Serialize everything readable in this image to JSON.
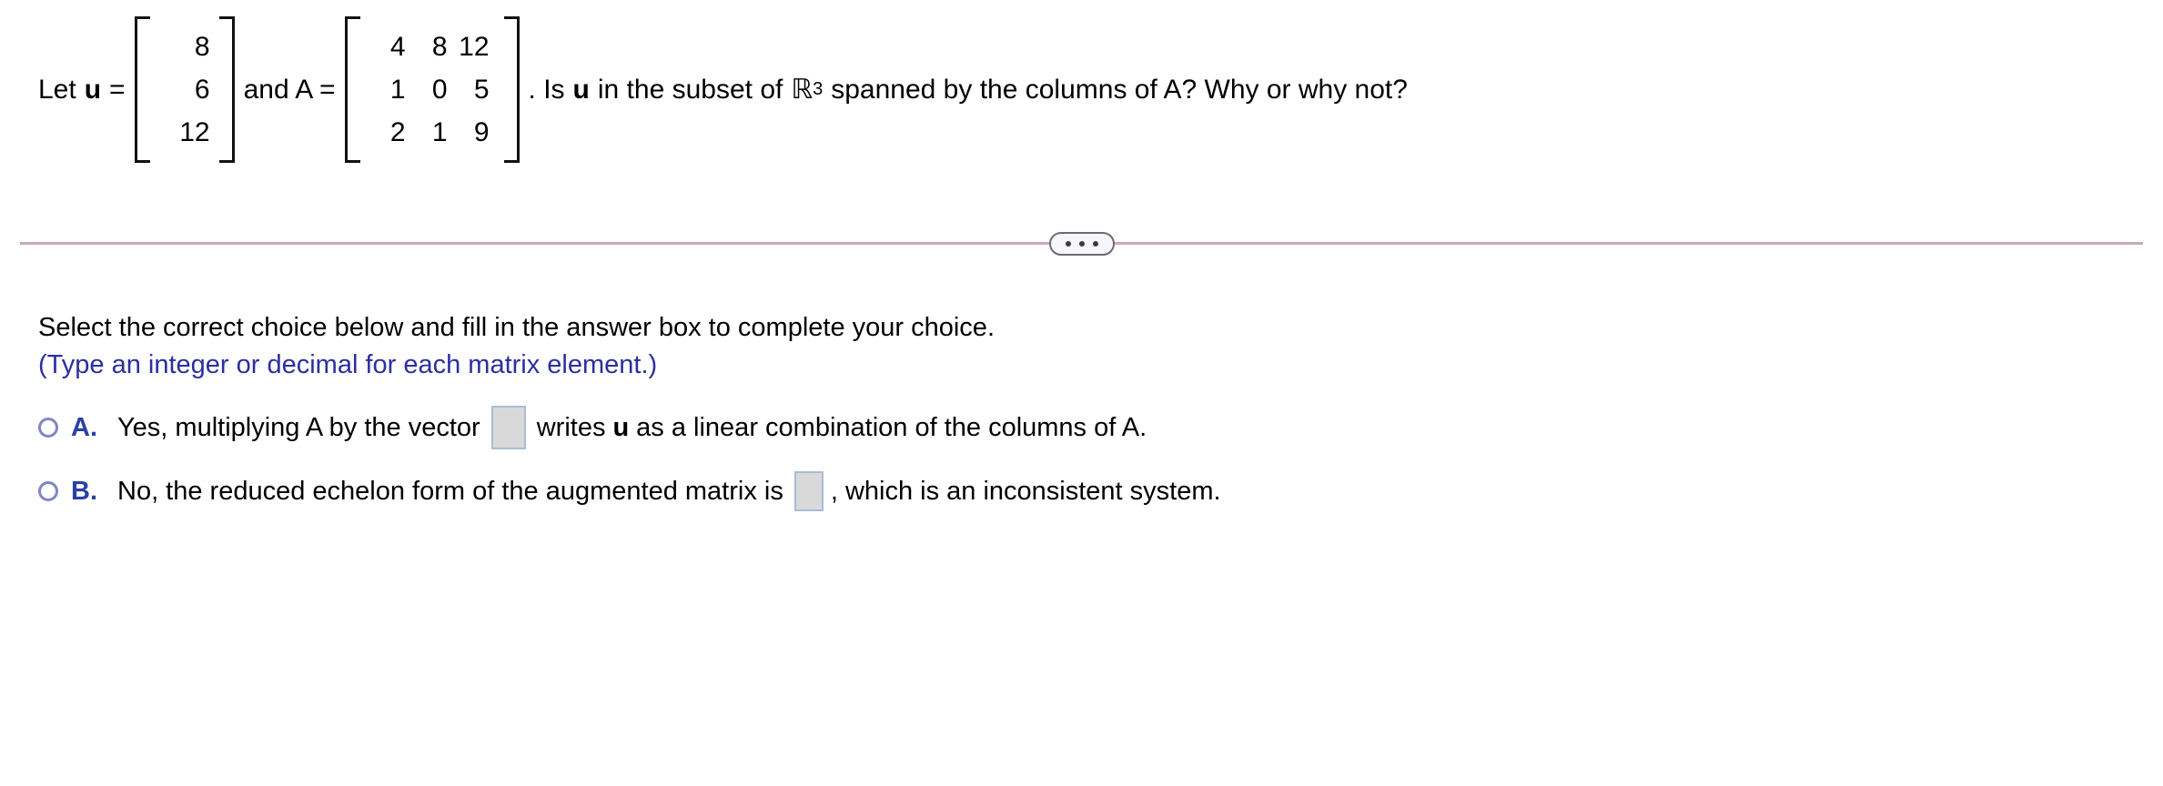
{
  "problem": {
    "lead_text": "Let",
    "vector_name": "u",
    "equals": "=",
    "conjunction": "and A =",
    "vector_u": {
      "rows": [
        [
          "8"
        ],
        [
          "6"
        ],
        [
          "12"
        ]
      ]
    },
    "matrix_A": {
      "rows": [
        [
          "4",
          "8",
          "12"
        ],
        [
          "1",
          "0",
          "5"
        ],
        [
          "2",
          "1",
          "9"
        ]
      ]
    },
    "question_part1": ". Is",
    "question_bold": "u",
    "question_part2": "in the subset of",
    "r_symbol": "ℝ",
    "r_exponent": "3",
    "question_part3": "spanned by the columns of A? Why or why not?"
  },
  "divider": {
    "ellipsis_label": "...",
    "line_color": "#c9aab3",
    "pill_border_color": "#6b6b78"
  },
  "answer_section": {
    "instruction": "Select the correct choice below and fill in the answer box to complete your choice.",
    "hint": "(Type an integer or decimal for each matrix element.)",
    "hint_color": "#2b2fa0",
    "accent_color": "#2b3fa8",
    "choices": [
      {
        "letter": "A.",
        "text_before_box": "Yes, multiplying A by the vector",
        "box_type": "vector",
        "box_value": "",
        "text_after_box_1": "writes",
        "bold_token": "u",
        "text_after_box_2": "as a linear combination of the columns of A."
      },
      {
        "letter": "B.",
        "text_before_box": "No, the reduced echelon form of the augmented matrix is",
        "box_type": "matrix",
        "box_value": "",
        "text_after_box_1": ", which is an inconsistent system.",
        "bold_token": "",
        "text_after_box_2": ""
      }
    ]
  }
}
